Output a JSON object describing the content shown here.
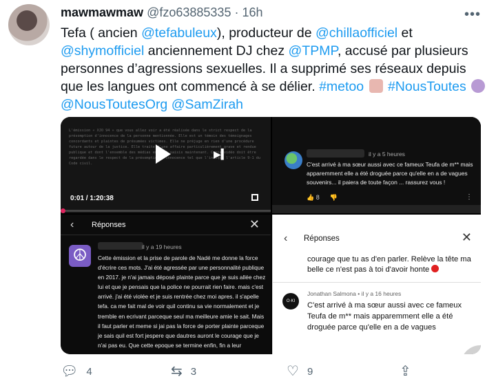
{
  "tweet": {
    "name": "mawmawmaw",
    "handle": "@fzo63885335",
    "separator": "·",
    "time": "16h",
    "text_parts": [
      {
        "t": "Tefa ( ancien ",
        "k": "text"
      },
      {
        "t": "@tefabuleux",
        "k": "mention"
      },
      {
        "t": "), producteur de ",
        "k": "text"
      },
      {
        "t": "@chillaofficiel",
        "k": "mention"
      },
      {
        "t": " et ",
        "k": "text"
      },
      {
        "t": "@shymofficiel",
        "k": "mention"
      },
      {
        "t": " anciennement DJ chez ",
        "k": "text"
      },
      {
        "t": "@TPMP",
        "k": "mention"
      },
      {
        "t": ", accusé par plusieurs personnes d’agressions sexuelles. Il a supprimé ses réseaux depuis que les langues ont commencé à se délier. ",
        "k": "text"
      },
      {
        "t": "#metoo",
        "k": "hashtag"
      },
      {
        "t": " ",
        "k": "emoji1"
      },
      {
        "t": " ",
        "k": "text"
      },
      {
        "t": "#NousToutes",
        "k": "hashtag"
      },
      {
        "t": " ",
        "k": "emoji2"
      },
      {
        "t": " ",
        "k": "text"
      },
      {
        "t": "@NousToutesOrg",
        "k": "mention"
      },
      {
        "t": " ",
        "k": "text"
      },
      {
        "t": "@SamZirah",
        "k": "mention"
      }
    ]
  },
  "media": {
    "video": {
      "overlay_text": "L'émission « XJO 94 » que vous allez voir a été réalisée dans le strict respect de la présomption d'innocence de la personne mentionnée. Elle est un témoin des témoignages concordants et plaintes de présumées victimes. Elle ne préjuge en rien d'une procédure future autour de la justice. Elle traite d'une affaire particulièrement grave et rendue publique et dont l'ensemble des médias en sont saisis maintenant. Cette vidéo doit être regardée dans le respect de la présomption d'innocence tel que l'indique l'article 9-1 du Code civil.",
      "timecode": "0:01 / 1:20:38"
    },
    "dark_comment": {
      "time": "il y a 5 heures",
      "text": "C'est arrivé à ma sœur aussi avec ce fameux Teufa de m** mais apparemment elle a été droguée parce qu'elle en a de vagues souvenirs... il paiera de toute façon ... rassurez vous !",
      "likes": "8"
    },
    "dark_thread": {
      "title": "Réponses",
      "time": "il y a 19 heures",
      "text": "Cette émission et la prise de parole de Nadé me donne la force d'écrire ces mots. J'ai été agressée par une personnalité publique en 2017. je n'ai jamais déposé plainte parce que je suis allée chez lui et que je pensais que la police ne pourrait rien faire. mais c'est arrivé. j'ai été violée et je suis rentrée chez moi apres. il s'apelle tefa. ca me fait mal de voir quil continu sa vie normalement et je tremble en ecrivant parceque seul ma meilleure amie le sait. Mais il faut parler et meme si jai pas la force de porter plainte parceque je sais quil est fort jespere que dautres auront le courage que je n'ai pas eu. Que cette epoque se termine enfin, fin a leur"
    },
    "light_thread": {
      "title": "Réponses",
      "text1": "courage que tu as d'en parler. Relève la tête ma belle ce n'est pas à toi d'avoir honte",
      "avatar_text": "O·KI",
      "meta": "Jonathan Salmona • il y a 16 heures",
      "text2": "C'est arrivé à ma sœur aussi avec ce fameux Teufa de m** mais apparemment elle a été droguée parce qu'elle en a de vagues"
    }
  },
  "actions": {
    "replies": "4",
    "retweets": "3",
    "likes": "9"
  },
  "icons": {
    "reply": "reply-icon",
    "retweet": "retweet-icon",
    "like": "heart-icon",
    "share": "share-icon",
    "more": "more-icon"
  },
  "colors": {
    "link": "#1d9bf0",
    "secondary_text": "#536471"
  }
}
